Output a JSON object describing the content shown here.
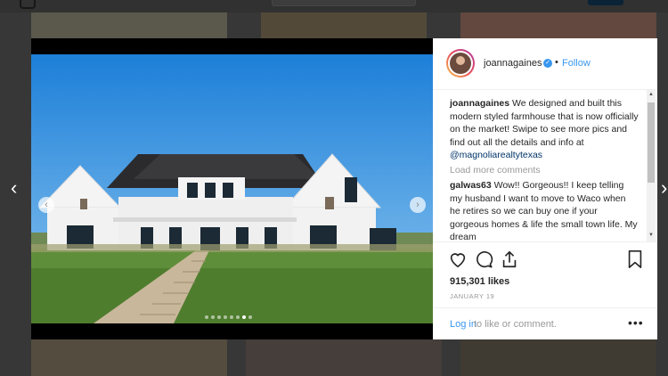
{
  "nav": {
    "prev_icon": "chevron-left-icon",
    "next_icon": "chevron-right-icon"
  },
  "post": {
    "username": "joannagaines",
    "verified_icon": "verified-badge-icon",
    "separator": "•",
    "follow_label": "Follow",
    "caption": {
      "user": "joannagaines",
      "text_1": " We designed and built this modern styled farmhouse that is now officially on the market! Swipe to see more pics and find out all the details and info at ",
      "mention": "@magnoliarealtytexas"
    },
    "load_more": "Load more comments",
    "comment": {
      "user": "galwas63",
      "text": " Wow!! Gorgeous!! I keep telling my husband I want to move to Waco when he retires so we can buy one if your gorgeous homes & life the small town life. My dream"
    },
    "likes": "915,301 likes",
    "date": "JANUARY 19",
    "login_link": "Log in",
    "login_rest": " to like or comment.",
    "more_label": "•••",
    "carousel": {
      "slides": 8,
      "active_index": 6
    }
  },
  "colors": {
    "accent": "#3897f0",
    "mention": "#003569",
    "text": "#262626",
    "muted": "#999999"
  }
}
